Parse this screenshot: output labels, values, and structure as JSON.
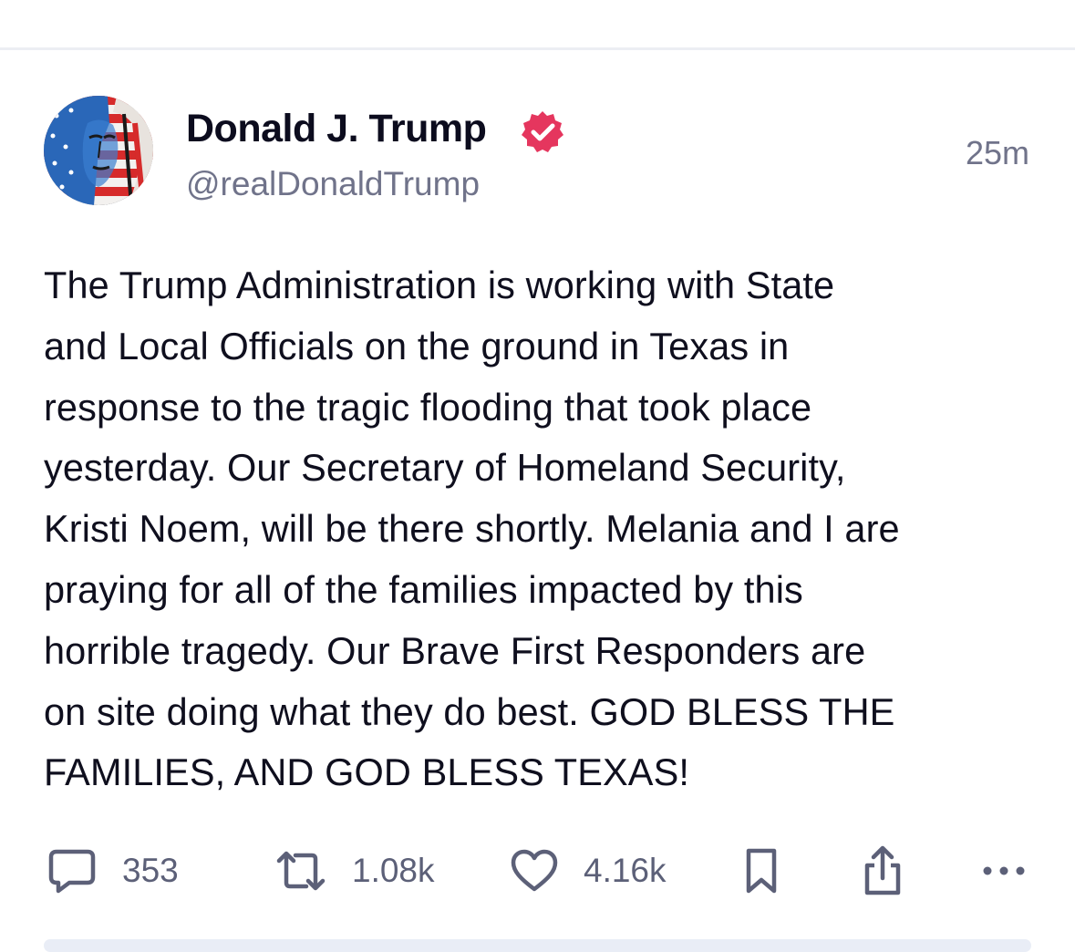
{
  "post": {
    "author_name": "Donald J. Trump",
    "handle": "@realDonaldTrump",
    "timestamp": "25m",
    "verified": true,
    "avatar_icon": "flag-portrait-avatar",
    "body_lines": [
      "The Trump Administration is working with State",
      "and Local Officials on the ground in Texas in",
      "response to the tragic flooding that took place",
      "yesterday. Our Secretary of Homeland Security,",
      "Kristi Noem, will be there shortly. Melania and I are",
      "praying for all of the families impacted by this",
      "horrible tragedy. Our Brave First Responders are",
      "on site doing what they do best. GOD BLESS THE",
      "FAMILIES, AND GOD BLESS TEXAS!"
    ]
  },
  "actions": {
    "reply_count": "353",
    "retruth_count": "1.08k",
    "like_count": "4.16k",
    "icons": [
      "reply-icon",
      "retruth-icon",
      "like-icon",
      "bookmark-icon",
      "share-icon",
      "more-icon"
    ]
  },
  "colors": {
    "text": "#0f0f1e",
    "muted": "#70738a",
    "verified_badge": "#e5365e",
    "divider": "#eceef3"
  }
}
